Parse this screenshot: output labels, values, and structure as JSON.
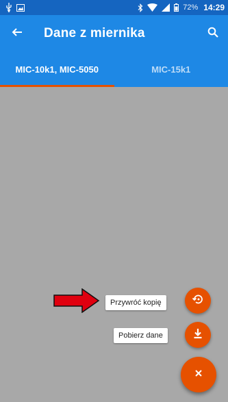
{
  "status_bar": {
    "battery_percent": "72%",
    "time": "14:29",
    "icons": [
      "usb-icon",
      "image-notification-icon",
      "bluetooth-icon",
      "wifi-icon",
      "signal-icon",
      "battery-icon"
    ]
  },
  "app_bar": {
    "title": "Dane z miernika",
    "back_icon": "arrow-left-icon",
    "search_icon": "search-icon"
  },
  "tabs": [
    {
      "label": "MIC-10k1, MIC-5050",
      "active": true
    },
    {
      "label": "MIC-15k1",
      "active": false
    }
  ],
  "fab_menu": {
    "restore_label": "Przywróć kopię",
    "restore_icon": "restore-icon",
    "download_label": "Pobierz dane",
    "download_icon": "download-icon",
    "close_icon": "close-icon"
  },
  "colors": {
    "status_bar": "#1565C0",
    "app_bar": "#1E88E5",
    "accent": "#E65100",
    "scrim": "#A8A8A8",
    "arrow": "#E0000F"
  }
}
